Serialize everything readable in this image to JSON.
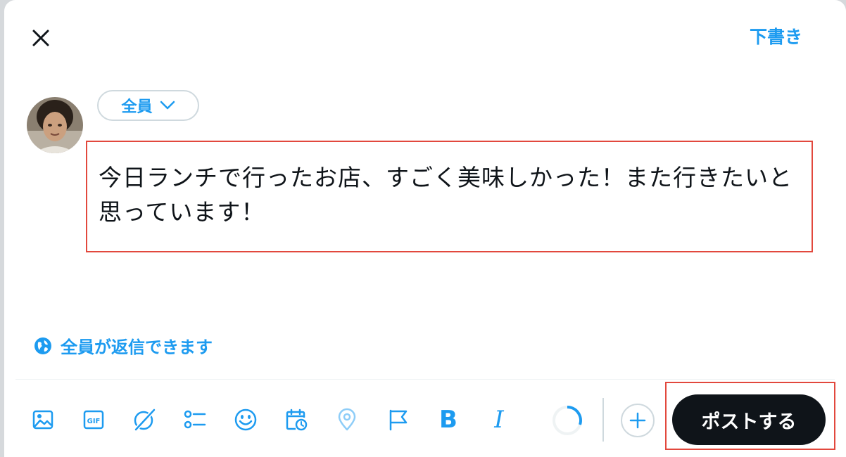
{
  "header": {
    "close_icon": "close-icon",
    "drafts_label": "下書き"
  },
  "composer": {
    "audience_label": "全員",
    "text": "今日ランチで行ったお店、すごく美味しかった！また行きたいと思っています！",
    "reply_setting_label": "全員が返信できます"
  },
  "toolbar": {
    "icons": [
      "image-icon",
      "gif-icon",
      "grok-icon",
      "poll-icon",
      "emoji-icon",
      "schedule-icon",
      "location-icon",
      "flag-icon",
      "bold-icon",
      "italic-icon"
    ],
    "bold_glyph": "B",
    "italic_glyph": "I",
    "post_label": "ポストする"
  },
  "colors": {
    "accent": "#1d9bf0",
    "highlight": "#e2483d",
    "post_button": "#0f1419"
  }
}
